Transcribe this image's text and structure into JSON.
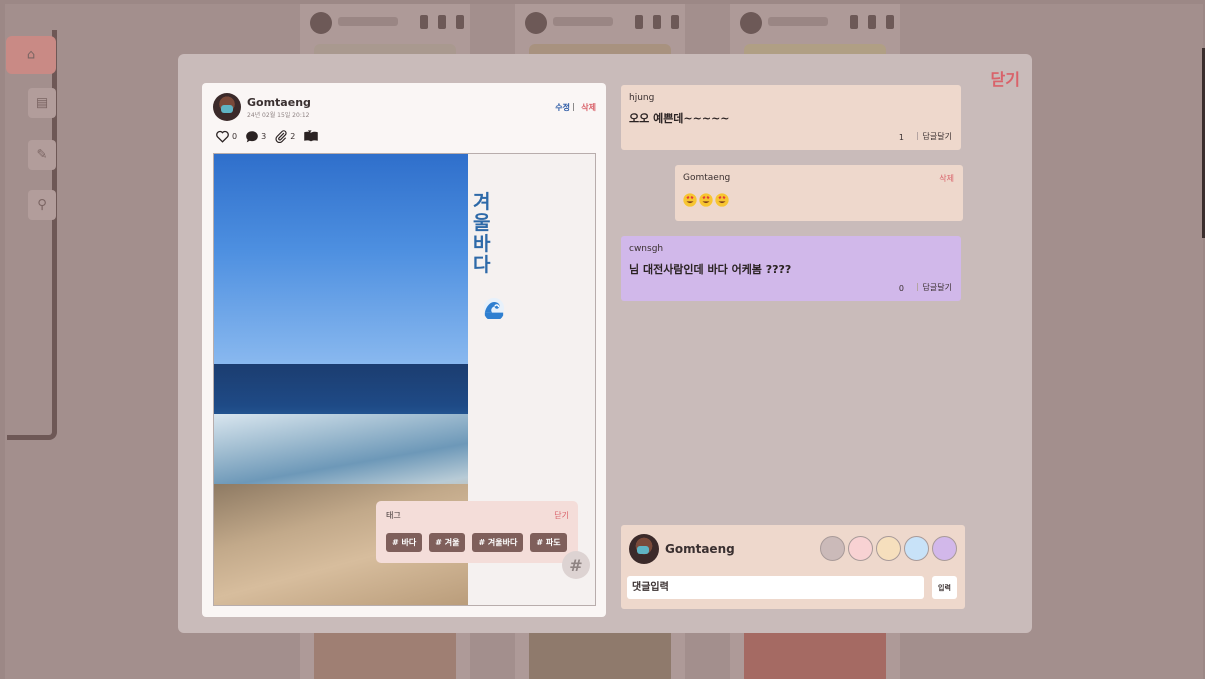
{
  "modal": {
    "close_label": "닫기"
  },
  "post": {
    "author": "Gomtaeng",
    "date": "24년 02월 15일 20:12",
    "edit_label": "수정",
    "separator": "|",
    "delete_label": "삭제",
    "likes": "0",
    "comments": "3",
    "attachments": "2",
    "title_chars": [
      "겨",
      "울",
      "바",
      "다"
    ],
    "title_emoji": "wave-icon"
  },
  "tag_popup": {
    "title": "태그",
    "close_label": "닫기",
    "tags": [
      "# 바다",
      "# 겨울",
      "# 겨울바다",
      "# 파도"
    ],
    "hash_label": "#"
  },
  "comments": [
    {
      "author": "hjung",
      "text": "오오 예쁜데~~~~~",
      "reply_count": "1",
      "reply_label": "답글달기",
      "color": "#eed8cc"
    },
    {
      "author": "Gomtaeng",
      "text_emoji": [
        "heart-eyes-emoji",
        "heart-eyes-emoji",
        "heart-eyes-emoji"
      ],
      "delete_label": "삭제",
      "color": "#eed8cc"
    },
    {
      "author": "cwnsgh",
      "text": "님 대전사람인데 바다 어케봄 ????",
      "reply_count": "0",
      "reply_label": "답글달기",
      "color": "#d1b8ea"
    }
  ],
  "comment_form": {
    "author": "Gomtaeng",
    "swatches": [
      "#cbbab9",
      "#f8d2d3",
      "#f6dfbd",
      "#c8e2f8",
      "#d2b8ea"
    ],
    "placeholder": "댓글입력",
    "submit_label": "입력"
  },
  "colors": {
    "accent_red": "#d9626a",
    "edit_blue": "#2d5ba6",
    "title_blue": "#2d69a8",
    "tag_brown": "#7f5f5b"
  }
}
